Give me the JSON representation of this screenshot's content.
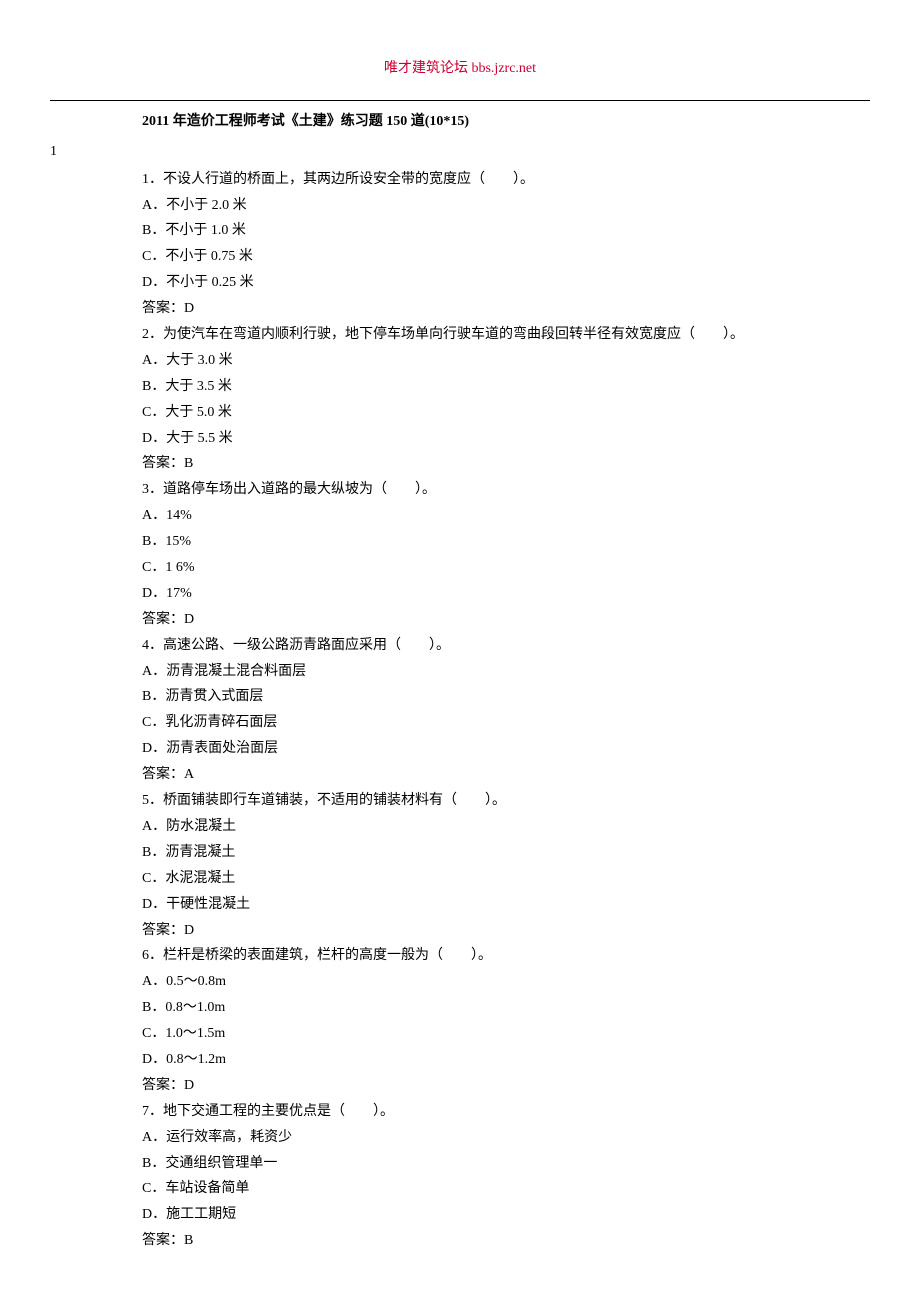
{
  "header": {
    "site_text": "唯才建筑论坛 bbs.jzrc.net"
  },
  "title": "2011 年造价工程师考试《土建》练习题 150 道(10*15)",
  "section_number": "1",
  "questions": [
    {
      "stem": "1．不设人行道的桥面上，其两边所设安全带的宽度应（　　）。",
      "options": [
        "A．不小于 2.0 米",
        "B．不小于 1.0 米",
        "C．不小于 0.75 米",
        "D．不小于 0.25 米"
      ],
      "answer": "答案：D"
    },
    {
      "stem": "2．为使汽车在弯道内顺利行驶，地下停车场单向行驶车道的弯曲段回转半径有效宽度应（　　）。",
      "options": [
        "A．大于 3.0 米",
        "B．大于 3.5 米",
        "C．大于 5.0 米",
        "D．大于 5.5 米"
      ],
      "answer": "答案：B"
    },
    {
      "stem": "3．道路停车场出入道路的最大纵坡为（　　）。",
      "options": [
        "A．14%",
        "B．15%",
        "C．1 6%",
        "D．17%"
      ],
      "answer": "答案：D"
    },
    {
      "stem": "4．高速公路、一级公路沥青路面应采用（　　）。",
      "options": [
        "A．沥青混凝土混合料面层",
        "B．沥青贯入式面层",
        "C．乳化沥青碎石面层",
        "D．沥青表面处治面层"
      ],
      "answer": "答案：A"
    },
    {
      "stem": "5．桥面铺装即行车道铺装，不适用的铺装材料有（　　）。",
      "options": [
        "A．防水混凝土",
        "B．沥青混凝土",
        "C．水泥混凝土",
        "D．干硬性混凝土"
      ],
      "answer": "答案：D"
    },
    {
      "stem": "6．栏杆是桥梁的表面建筑，栏杆的高度一般为（　　）。",
      "options": [
        "A．0.5～0.8m",
        "B．0.8～1.0m",
        "C．1.0～1.5m",
        "D．0.8～1.2m"
      ],
      "answer": "答案：D"
    },
    {
      "stem": "7．地下交通工程的主要优点是（　　）。",
      "options": [
        "A．运行效率高，耗资少",
        "B．交通组织管理单一",
        "C．车站设备简单",
        "D．施工工期短"
      ],
      "answer": "答案：B"
    }
  ]
}
